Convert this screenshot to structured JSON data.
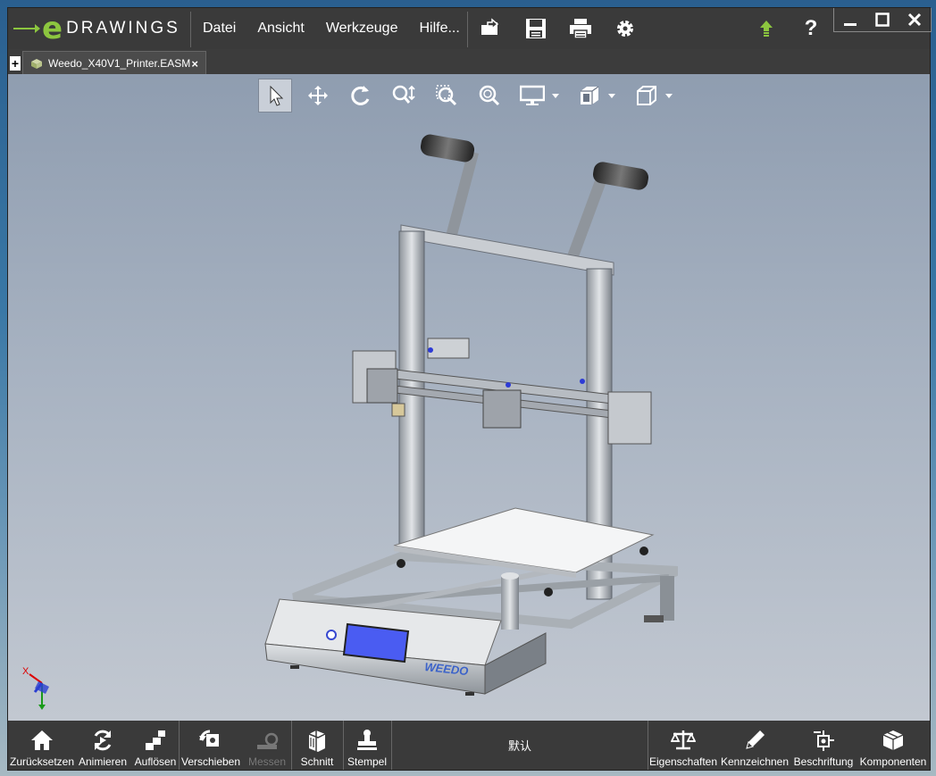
{
  "app": {
    "logo_text": "DRAWINGS",
    "logo_e": "e"
  },
  "menu": [
    "Datei",
    "Ansicht",
    "Werkzeuge",
    "Hilfe..."
  ],
  "toolbar_icons": [
    "open-icon",
    "save-icon",
    "print-icon",
    "gear-icon"
  ],
  "window_controls": [
    "upload-icon",
    "help-icon",
    "minimize-icon",
    "maximize-icon",
    "close-icon"
  ],
  "help_label": "?",
  "tab": {
    "plus": "+",
    "title": "Weedo_X40V1_Printer.EASM",
    "close": "×"
  },
  "view_tools": [
    "select-icon",
    "pan-icon",
    "rotate-icon",
    "zoom-icon",
    "zoom-area-icon",
    "zoom-fit-icon",
    "display-mode-icon",
    "views-icon",
    "standard-view-icon"
  ],
  "model": {
    "brand_text": "WEEDO"
  },
  "axes": {
    "x": "X"
  },
  "bottom": {
    "left": [
      {
        "label": "Zurücksetzen",
        "icon": "home-icon"
      },
      {
        "label": "Animieren",
        "icon": "animate-icon"
      },
      {
        "label": "Auflösen",
        "icon": "explode-icon"
      },
      {
        "label": "Verschieben",
        "icon": "move-icon"
      },
      {
        "label": "Messen",
        "icon": "measure-icon"
      },
      {
        "label": "Schnitt",
        "icon": "section-icon"
      },
      {
        "label": "Stempel",
        "icon": "stamp-icon"
      }
    ],
    "config": "默认",
    "right": [
      {
        "label": "Eigenschaften",
        "icon": "scale-icon"
      },
      {
        "label": "Kennzeichnen",
        "icon": "pencil-icon"
      },
      {
        "label": "Beschriftung",
        "icon": "annotation-icon"
      },
      {
        "label": "Komponenten",
        "icon": "components-icon"
      }
    ]
  },
  "colors": {
    "accent": "#8cc63f",
    "chrome": "#3a3a3a",
    "screen": "#4a5cf2"
  }
}
